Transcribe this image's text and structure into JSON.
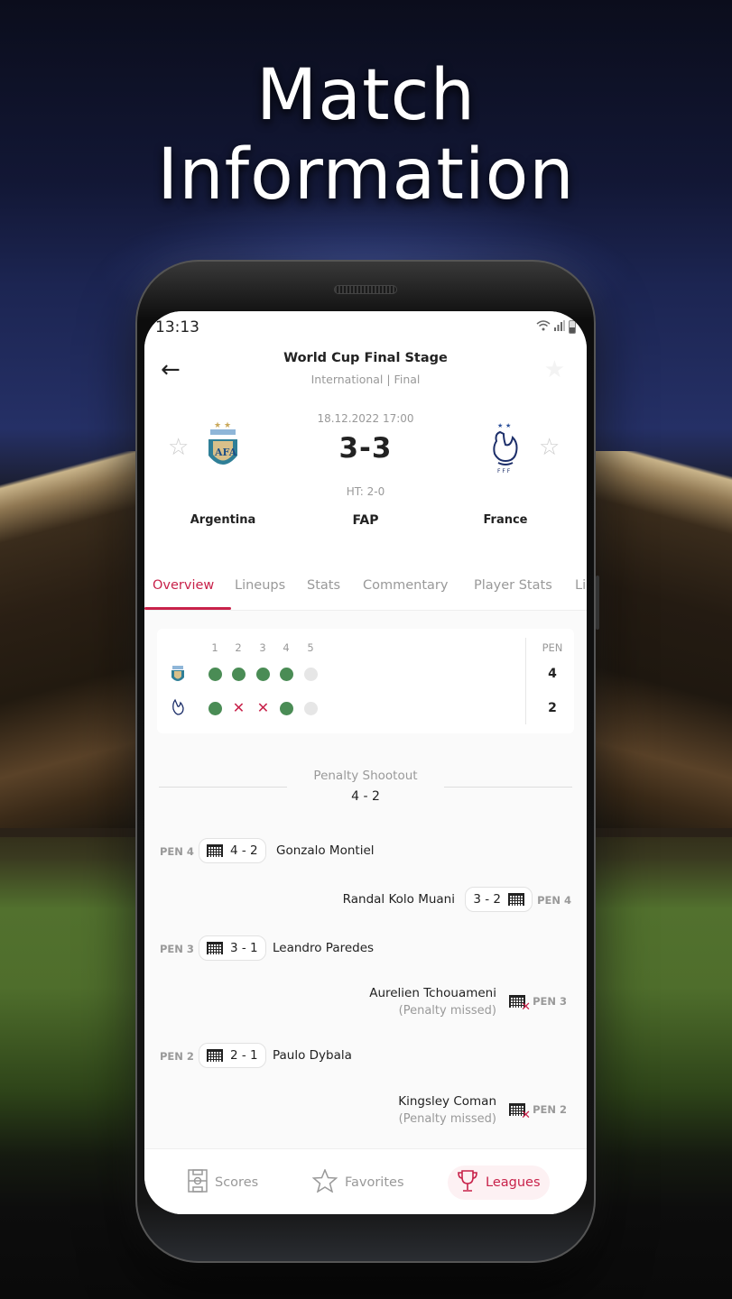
{
  "promo": {
    "headline_line1": "Match",
    "headline_line2": "Information"
  },
  "status_bar": {
    "time": "13:13",
    "icons": [
      "wifi-icon",
      "signal-icon",
      "battery-icon"
    ]
  },
  "header": {
    "competition": "World Cup Final Stage",
    "subtitle": "International | Final",
    "date": "18.12.2022 17:00",
    "score": "3-3",
    "half_time": "HT: 2-0",
    "status": "FAP",
    "home_team": {
      "name": "Argentina",
      "crest": "argentina-crest-icon"
    },
    "away_team": {
      "name": "France",
      "crest": "france-crest-icon"
    }
  },
  "tabs": [
    {
      "label": "Overview",
      "active": true
    },
    {
      "label": "Lineups",
      "active": false
    },
    {
      "label": "Stats",
      "active": false
    },
    {
      "label": "Commentary",
      "active": false
    },
    {
      "label": "Player Stats",
      "active": false
    },
    {
      "label": "Li",
      "active": false
    }
  ],
  "penalty_grid": {
    "columns": [
      "1",
      "2",
      "3",
      "4",
      "5"
    ],
    "total_header": "PEN",
    "home": {
      "results": [
        "scored",
        "scored",
        "scored",
        "scored",
        "pending"
      ],
      "total": "4"
    },
    "away": {
      "results": [
        "scored",
        "missed",
        "missed",
        "scored",
        "pending"
      ],
      "total": "2"
    },
    "miss_glyph": "✕"
  },
  "shootout": {
    "title": "Penalty Shootout",
    "score": "4 - 2"
  },
  "events": [
    {
      "side": "home",
      "pen": "PEN 4",
      "score": "4 - 2",
      "player": "Gonzalo Montiel",
      "missed": false
    },
    {
      "side": "away",
      "pen": "PEN 4",
      "score": "3 - 2",
      "player": "Randal Kolo Muani",
      "missed": false
    },
    {
      "side": "home",
      "pen": "PEN 3",
      "score": "3 - 1",
      "player": "Leandro Paredes",
      "missed": false
    },
    {
      "side": "away",
      "pen": "PEN 3",
      "player": "Aurelien Tchouameni",
      "note": "(Penalty missed)",
      "missed": true
    },
    {
      "side": "home",
      "pen": "PEN 2",
      "score": "2 - 1",
      "player": "Paulo Dybala",
      "missed": false
    },
    {
      "side": "away",
      "pen": "PEN 2",
      "player": "Kingsley Coman",
      "note": "(Penalty missed)",
      "missed": true
    }
  ],
  "bottom_nav": [
    {
      "label": "Scores",
      "icon": "pitch-icon",
      "active": false
    },
    {
      "label": "Favorites",
      "icon": "star-icon",
      "active": false
    },
    {
      "label": "Leagues",
      "icon": "trophy-icon",
      "active": true
    }
  ],
  "colors": {
    "accent": "#c8224a",
    "scored": "#4a8c55",
    "pending": "#e6e6e6"
  },
  "glyphs": {
    "back": "←",
    "star": "☆",
    "star_filled": "★",
    "x": "✕"
  }
}
